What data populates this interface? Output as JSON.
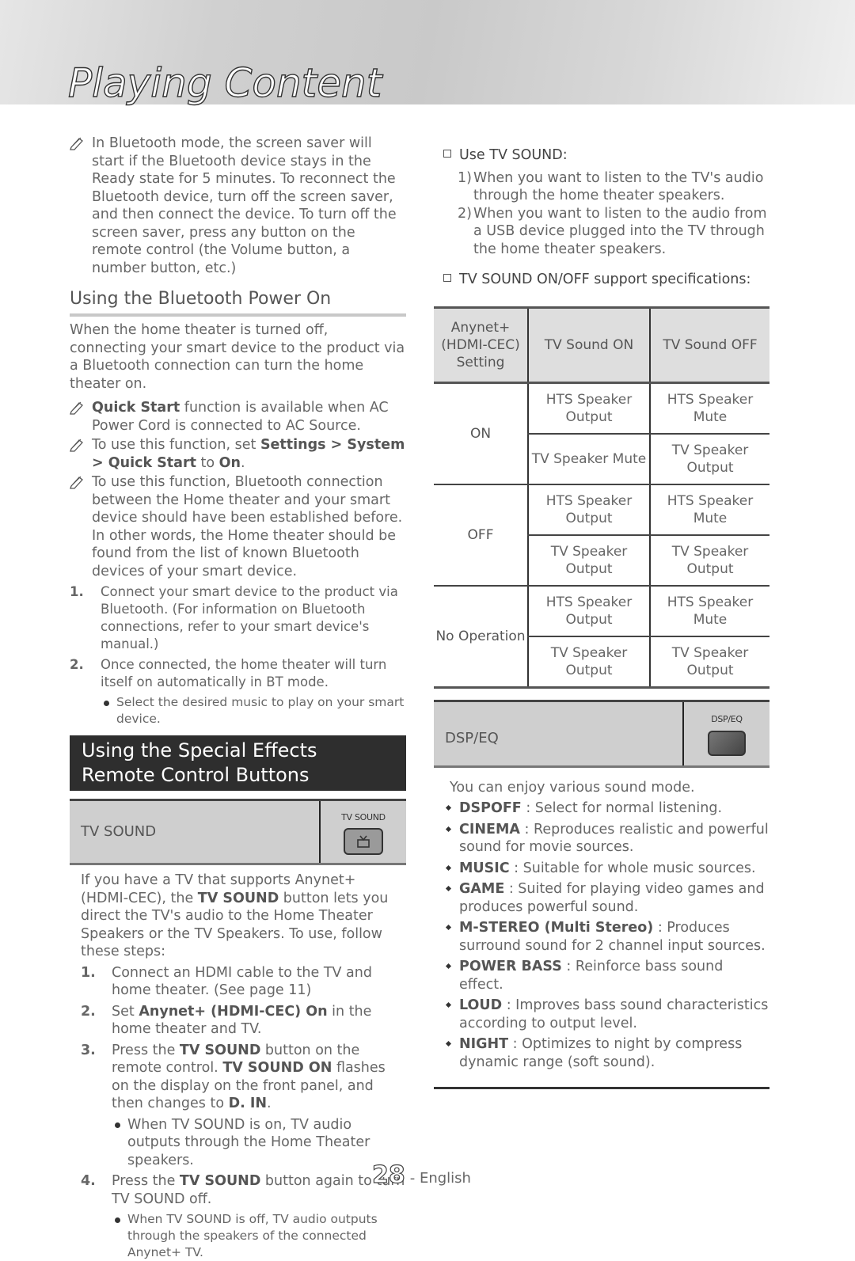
{
  "header": {
    "title": "Playing Content"
  },
  "left": {
    "note_screensaver": "In Bluetooth mode, the screen saver will start if the Bluetooth device stays in the Ready state for 5 minutes. To reconnect the Bluetooth device, turn off the screen saver, and then connect the device. To turn off the screen saver, press any button on the remote control (the Volume button, a number button, etc.)",
    "bt_power": {
      "heading": "Using the Bluetooth Power On",
      "intro": "When the home theater is turned off, connecting your smart device to the product via a Bluetooth connection can turn the home theater on.",
      "note1_bold": "Quick Start",
      "note1_rest": " function is available when AC Power Cord is connected to AC Source.",
      "note2_pre": "To use this function, set ",
      "note2_bold1": "Settings > System > Quick Start",
      "note2_mid": " to ",
      "note2_bold2": "On",
      "note2_end": ".",
      "note3": "To use this function, Bluetooth connection between the Home theater and your smart device should have been established before. In other words, the Home theater should be found from the list of known Bluetooth devices of your smart device.",
      "steps": [
        {
          "num": "1.",
          "text": "Connect your smart device to the product via Bluetooth. (For information on Bluetooth connections, refer to your smart device's manual.)"
        },
        {
          "num": "2.",
          "text": "Once connected, the home theater will turn itself on automatically in BT mode."
        }
      ],
      "step2_bullet": "Select the desired music to play on your smart device."
    },
    "special_effects": {
      "banner": "Using the Special Effects Remote Control Buttons",
      "tv_sound_label": "TV SOUND",
      "tv_sound_button_caption": "TV SOUND",
      "intro_pre": "If you have a TV that supports Anynet+ (HDMI-CEC), the ",
      "intro_bold": "TV SOUND",
      "intro_post": " button lets you direct the TV's audio to the Home Theater Speakers or the TV Speakers. To use, follow these steps:",
      "step1": "Connect an HDMI cable to the TV and home theater. (See page 11)",
      "step2_pre": "Set ",
      "step2_bold": "Anynet+ (HDMI-CEC) On",
      "step2_post": " in the home theater and TV.",
      "step3_pre": "Press the ",
      "step3_bold1": "TV SOUND",
      "step3_mid1": " button on the remote control. ",
      "step3_bold2": "TV SOUND ON",
      "step3_mid2": " flashes on the display on the front panel, and then changes to ",
      "step3_bold3": "D. IN",
      "step3_end": ".",
      "step3_bullet": "When TV SOUND is on, TV audio outputs through the Home Theater speakers.",
      "step4_pre": "Press the ",
      "step4_bold": "TV SOUND",
      "step4_post": " button again to turn TV SOUND off.",
      "step4_bullet": "When TV SOUND is off, TV audio outputs through the speakers of the connected Anynet+ TV.",
      "nums": [
        "1.",
        "2.",
        "3.",
        "4."
      ]
    }
  },
  "right": {
    "use_heading": "Use TV SOUND:",
    "use_items": [
      {
        "n": "1)",
        "text": "When you want to listen to the TV's audio through the home theater speakers."
      },
      {
        "n": "2)",
        "text": "When you want to listen to the audio from a USB device plugged into the TV through the home theater speakers."
      }
    ],
    "spec_heading": "TV SOUND ON/OFF support specifications:",
    "table": {
      "headers": [
        "Anynet+ (HDMI-CEC) Setting",
        "TV Sound ON",
        "TV Sound OFF"
      ],
      "groups": [
        {
          "setting": "ON",
          "rows": [
            [
              "HTS Speaker Output",
              "HTS Speaker Mute"
            ],
            [
              "TV Speaker Mute",
              "TV Speaker Output"
            ]
          ]
        },
        {
          "setting": "OFF",
          "rows": [
            [
              "HTS Speaker Output",
              "HTS Speaker Mute"
            ],
            [
              "TV Speaker Output",
              "TV Speaker Output"
            ]
          ]
        },
        {
          "setting": "No Operation",
          "rows": [
            [
              "HTS Speaker Output",
              "HTS Speaker Mute"
            ],
            [
              "TV Speaker Output",
              "TV Speaker Output"
            ]
          ]
        }
      ]
    },
    "dsp": {
      "label": "DSP/EQ",
      "button_caption": "DSP/EQ",
      "intro": "You can enjoy various sound mode.",
      "modes": [
        {
          "name": "DSPOFF",
          "desc": " : Select for normal listening."
        },
        {
          "name": "CINEMA",
          "desc": " : Reproduces realistic and powerful sound for movie sources."
        },
        {
          "name": "MUSIC",
          "desc": " : Suitable for whole music sources."
        },
        {
          "name": "GAME",
          "desc": " : Suited for playing video games and produces powerful sound."
        },
        {
          "name": "M-STEREO (Multi Stereo)",
          "desc": " : Produces surround sound for 2 channel input sources."
        },
        {
          "name": "POWER BASS",
          "desc": " : Reinforce bass sound effect."
        },
        {
          "name": "LOUD",
          "desc": " : Improves bass sound characteristics according to output level."
        },
        {
          "name": "NIGHT",
          "desc": " : Optimizes to night by compress dynamic range (soft sound)."
        }
      ]
    }
  },
  "footer": {
    "page_number": "28",
    "language": "- English"
  }
}
